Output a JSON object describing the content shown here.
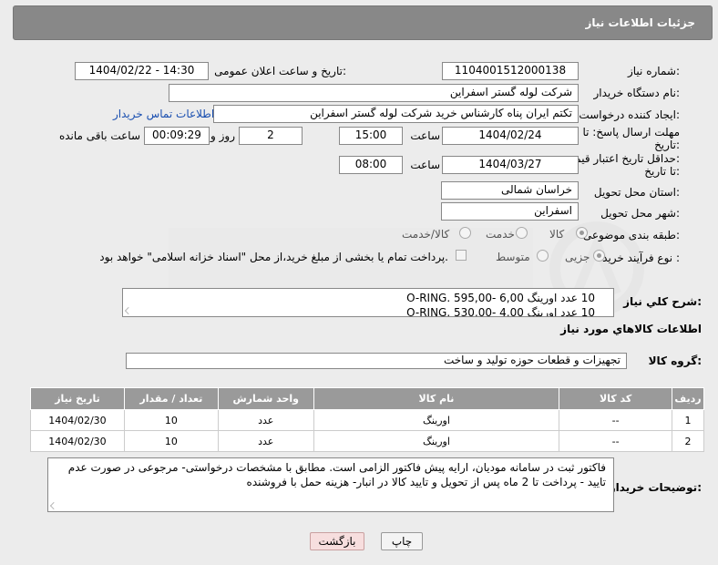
{
  "header": {
    "title": "جزئیات اطلاعات نیاز"
  },
  "fields": {
    "need_number_label": "شماره نیاز:",
    "need_number": "1104001512000138",
    "announce_label": "تاریخ و ساعت اعلان عمومی:",
    "announce_value": "1404/02/22 - 14:30",
    "buyer_org_label": "نام دستگاه خریدار:",
    "buyer_org": "شرکت لوله گستر اسفراین",
    "requester_label": "ایجاد کننده درخواست:",
    "requester": "تکتم ایران پناه کارشناس خرید شرکت لوله گستر اسفراین",
    "buyer_contact_link": "اطلاعات تماس خریدار",
    "deadline_label_1": "مهلت ارسال پاسخ: تا",
    "deadline_label_2": "تاریخ:",
    "deadline_date": "1404/02/24",
    "time_label": "ساعت",
    "deadline_time": "15:00",
    "days_count": "2",
    "days_label": "روز و",
    "remaining_time": "00:09:29",
    "remaining_label": "ساعت باقی مانده",
    "validity_label_1": "حداقل تاریخ اعتبار قیمت:",
    "validity_label_2": "تا تاریخ:",
    "validity_date": "1404/03/27",
    "validity_time": "08:00",
    "province_label": "استان محل تحویل:",
    "province": "خراسان شمالی",
    "city_label": "شهر محل تحویل:",
    "city": "اسفراین",
    "category_label": "طبقه بندی موضوعی:",
    "category_options": [
      "کالا",
      "خدمت",
      "کالا/خدمت"
    ],
    "process_label": "نوع فرآیند خرید :",
    "process_options": [
      "جزیی",
      "متوسط"
    ],
    "payment_note": "پرداخت تمام یا بخشی از مبلغ خرید،از محل \"اسناد خزانه اسلامی\" خواهد بود.",
    "description_label": "شرح کلي نياز:",
    "description_lines": [
      "10 عدد اورینگ O-RING. 595,00- 6,00",
      "10 عدد اورینگ O-RING. 530,00- 4,00"
    ],
    "items_info_title": "اطلاعات کالاهاي مورد نياز",
    "goods_group_label": "گروه کالا:",
    "goods_group": "تجهیزات و قطعات حوزه تولید و ساخت",
    "buyer_notes_label": "توضیحات خریدار:",
    "buyer_notes": "فاکتور ثبت در سامانه مودیان، ارایه پیش فاکتور الزامی است. مطابق با مشخصات درخواستی- مرجوعی در صورت عدم تایید - پرداخت تا 2 ماه پس از تحویل و تایید کالا در انبار- هزینه حمل با فروشنده"
  },
  "table": {
    "headers": [
      "ردیف",
      "کد کالا",
      "نام کالا",
      "واحد شمارش",
      "تعداد / مقدار",
      "تاریخ نیاز"
    ],
    "rows": [
      [
        "1",
        "--",
        "اورینگ",
        "عدد",
        "10",
        "1404/02/30"
      ],
      [
        "2",
        "--",
        "اورینگ",
        "عدد",
        "10",
        "1404/02/30"
      ]
    ]
  },
  "buttons": {
    "print": "چاپ",
    "back": "بازگشت"
  },
  "colors": {
    "header_bg": "#888888",
    "link": "#1a4fb0",
    "back_btn_bg": "#f7dede"
  }
}
